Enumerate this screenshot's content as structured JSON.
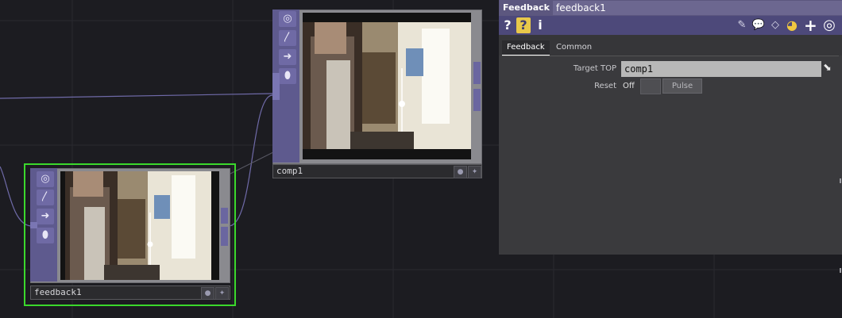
{
  "network": {
    "nodes": [
      {
        "name": "comp1",
        "flags": [
          "●",
          "✦"
        ]
      },
      {
        "name": "feedback1",
        "flags": [
          "●",
          "✦"
        ]
      }
    ],
    "side_buttons": [
      "◎",
      "〳",
      "➜",
      "⬮"
    ]
  },
  "panel": {
    "op_type": "Feedback",
    "op_name": "feedback1",
    "toolbar": {
      "help": "?",
      "python_help": "?",
      "info": "i",
      "icons": [
        "pencil-icon",
        "comment-icon",
        "clone-icon",
        "python-icon",
        "plus-icon",
        "target-icon"
      ],
      "pencil": "✎",
      "comment": "💬",
      "clone": "◇",
      "python": "◕",
      "plus": "+",
      "target": "◎"
    },
    "tabs": [
      "Feedback",
      "Common"
    ],
    "params": {
      "target_top_label": "Target TOP",
      "target_top_value": "comp1",
      "reset_label": "Reset",
      "reset_state": "Off",
      "pulse_label": "Pulse"
    }
  },
  "colors": {
    "background": "#1c1c21",
    "selected_outline": "#3bd82c",
    "node_side": "#5e5a8e",
    "panel_header": "#5c577f"
  }
}
